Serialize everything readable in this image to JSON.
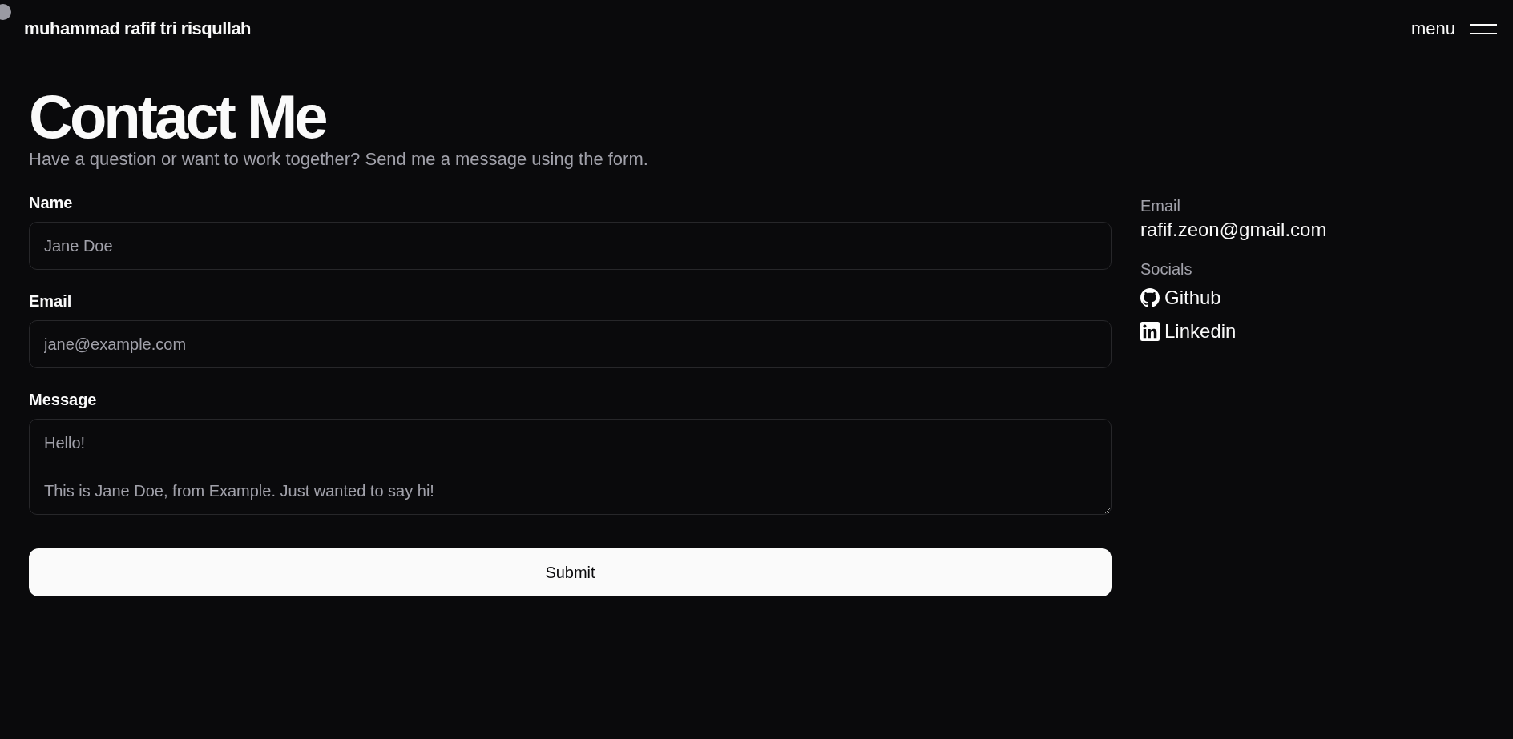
{
  "header": {
    "brand": "muhammad rafif tri risqullah",
    "menu_label": "menu"
  },
  "page": {
    "title": "Contact Me",
    "subtitle": "Have a question or want to work together? Send me a message using the form."
  },
  "form": {
    "fields": [
      {
        "kind": "input",
        "label": "Name",
        "placeholder": "Jane Doe"
      },
      {
        "kind": "input",
        "label": "Email",
        "placeholder": "jane@example.com"
      },
      {
        "kind": "textarea",
        "label": "Message",
        "placeholder": "Hello!\n\nThis is Jane Doe, from Example. Just wanted to say hi!"
      }
    ],
    "submit": "Submit"
  },
  "contact": {
    "email_label": "Email",
    "email": "rafif.zeon@gmail.com",
    "socials_label": "Socials",
    "socials": [
      {
        "kind": "github",
        "label": "Github"
      },
      {
        "kind": "linkedin",
        "label": "Linkedin"
      }
    ]
  }
}
